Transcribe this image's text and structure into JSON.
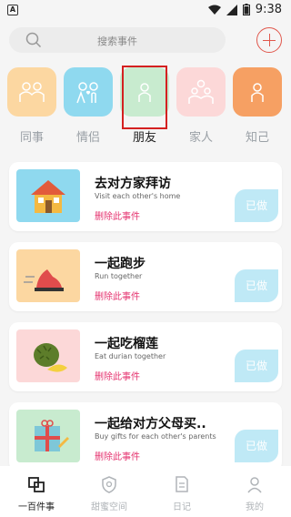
{
  "status": {
    "time": "9:38",
    "app_letter": "A"
  },
  "search": {
    "placeholder": "搜索事件"
  },
  "categories": [
    {
      "label": "同事",
      "color": "#fcd7a1"
    },
    {
      "label": "情侣",
      "color": "#8fd9ef"
    },
    {
      "label": "朋友",
      "color": "#c8ebcf"
    },
    {
      "label": "家人",
      "color": "#fcd8d8"
    },
    {
      "label": "知己",
      "color": "#f6a063"
    }
  ],
  "events": [
    {
      "title": "去对方家拜访",
      "subtitle": "Visit each other's home",
      "delete_label": "删除此事件",
      "done_label": "已做",
      "thumb_color": "#8fd9ef"
    },
    {
      "title": "一起跑步",
      "subtitle": "Run together",
      "delete_label": "删除此事件",
      "done_label": "已做",
      "thumb_color": "#fcd7a1"
    },
    {
      "title": "一起吃榴莲",
      "subtitle": "Eat durian together",
      "delete_label": "删除此事件",
      "done_label": "已做",
      "thumb_color": "#fcd8d8"
    },
    {
      "title": "一起给对方父母买..",
      "subtitle": "Buy gifts for each other's parents",
      "delete_label": "删除此事件",
      "done_label": "已做",
      "thumb_color": "#c8ebcf"
    }
  ],
  "tabs": [
    {
      "label": "一百件事"
    },
    {
      "label": "甜蜜空间"
    },
    {
      "label": "日记"
    },
    {
      "label": "我的"
    }
  ]
}
